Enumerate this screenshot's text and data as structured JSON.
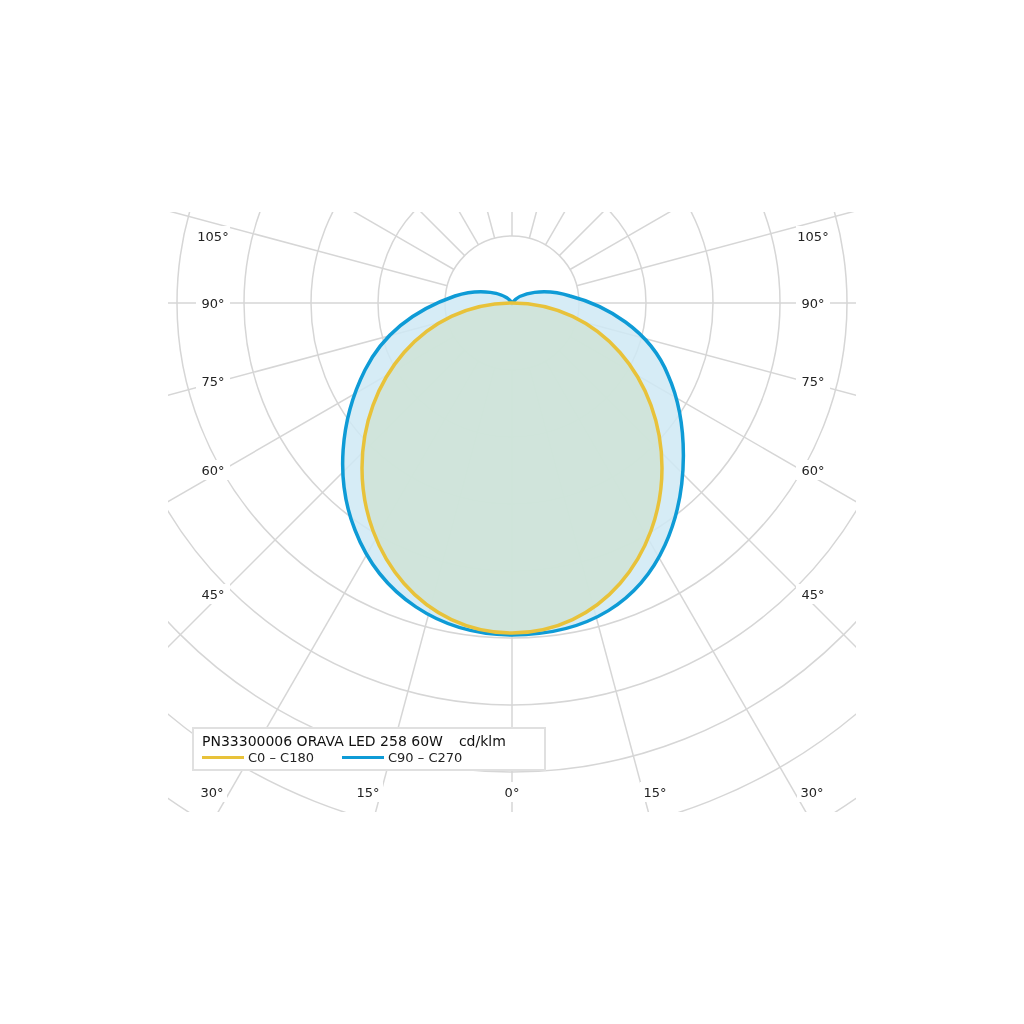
{
  "diagram": {
    "left_angle_labels": [
      "105°",
      "90°",
      "75°",
      "60°",
      "45°"
    ],
    "right_angle_labels": [
      "105°",
      "90°",
      "75°",
      "60°",
      "45°"
    ],
    "bottom_angle_labels": [
      "30°",
      "15°",
      "0°",
      "15°",
      "30°"
    ]
  },
  "legend": {
    "title": "PN33300006 ORAVA LED 258 60W",
    "unit": "cd/klm",
    "items": [
      {
        "label": "C0 – C180",
        "color": "#e8c23a",
        "kind": "inner"
      },
      {
        "label": "C90 – C270",
        "color": "#0e9bd6",
        "kind": "outer"
      }
    ]
  }
}
